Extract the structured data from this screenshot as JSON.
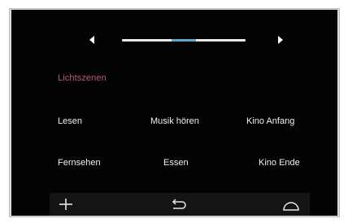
{
  "section_title": "Lichtszenen",
  "pager": {
    "pages": 3,
    "current_page": 2
  },
  "navigation": {
    "prev_icon": "caret-left-icon",
    "next_icon": "caret-right-icon"
  },
  "scenes": [
    "Lesen",
    "Musik hören",
    "Kino Anfang",
    "Fernsehen",
    "Essen",
    "Kino Ende"
  ],
  "bottom_bar": {
    "add_icon": "plus-icon",
    "back_icon": "back-arrow-icon",
    "home_icon": "dome-icon"
  },
  "colors": {
    "background": "#030303",
    "accent_title": "#c2577e",
    "pager_active": "#5aa7c9",
    "pager_track": "#e8e8e8",
    "text": "#f0f0f0"
  }
}
